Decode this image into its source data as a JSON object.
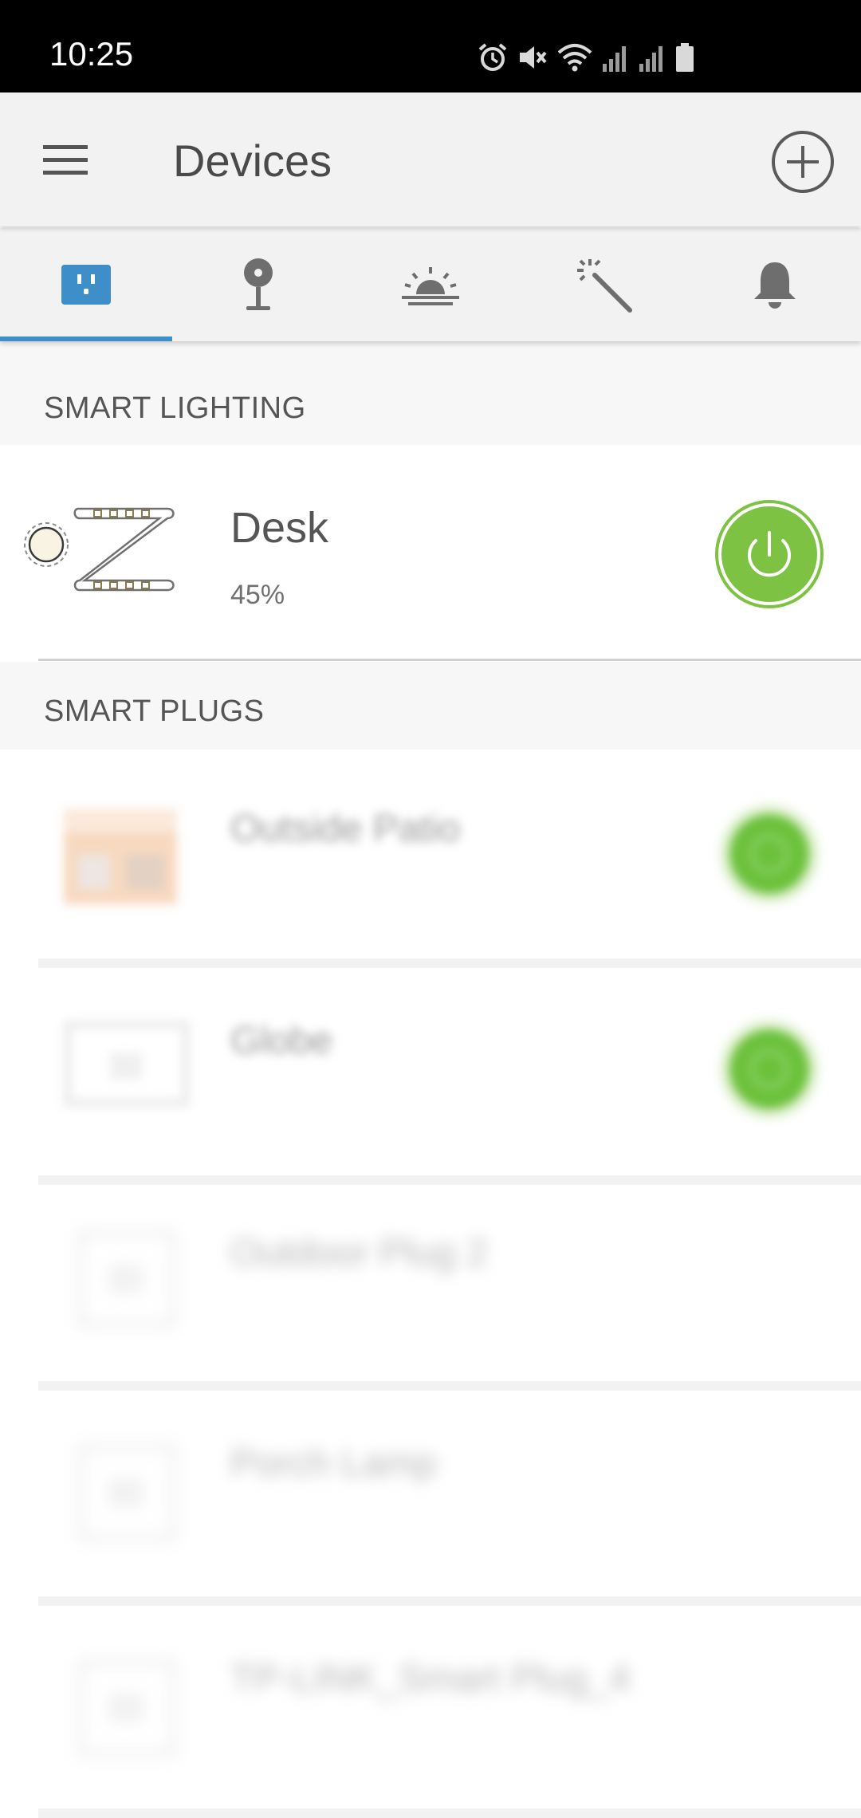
{
  "status_bar": {
    "time": "10:25",
    "icons": [
      "alarm-icon",
      "mute-icon",
      "wifi-icon",
      "signal-icon",
      "signal-icon",
      "battery-icon"
    ]
  },
  "header": {
    "title": "Devices",
    "menu_icon": "hamburger-menu-icon",
    "add_icon": "add-circle-icon"
  },
  "tabs": [
    {
      "icon": "plug-icon",
      "selected": true
    },
    {
      "icon": "camera-icon",
      "selected": false
    },
    {
      "icon": "sunrise-icon",
      "selected": false
    },
    {
      "icon": "magic-wand-icon",
      "selected": false
    },
    {
      "icon": "bell-icon",
      "selected": false
    }
  ],
  "sections": {
    "lighting": {
      "label": "SMART LIGHTING",
      "devices": [
        {
          "name": "Desk",
          "level": "45%",
          "power": "on",
          "icon": "light-strip-icon"
        }
      ]
    },
    "plugs": {
      "label": "SMART PLUGS",
      "devices": [
        {
          "name": "Outside Patio",
          "power": "on",
          "icon": "plug-device-icon"
        },
        {
          "name": "Globe",
          "power": "on",
          "icon": "outlet-device-icon"
        },
        {
          "name": "Outdoor Plug 2",
          "power": "offline",
          "icon": "outlet-device-icon"
        },
        {
          "name": "Porch Lamp",
          "power": "offline",
          "icon": "outlet-device-icon"
        },
        {
          "name": "TP-LINK_Smart Plug_4",
          "power": "offline",
          "icon": "outlet-device-icon"
        }
      ]
    }
  },
  "colors": {
    "accent_blue": "#3e8ec9",
    "power_green": "#7dc242",
    "header_bg": "#f2f2f2"
  }
}
